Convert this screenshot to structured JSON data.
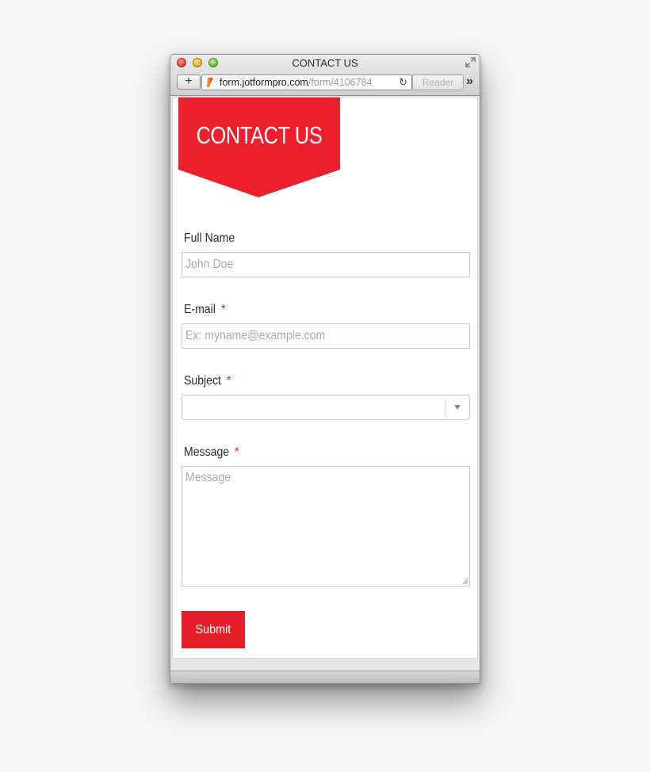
{
  "window": {
    "title": "CONTACT US",
    "url_host": "form.jotformpro.com",
    "url_path": "/form/4106784",
    "reader_label": "Reader"
  },
  "banner": {
    "text": "CONTACT US",
    "color": "#e41f2b"
  },
  "form": {
    "full_name": {
      "label": "Full Name",
      "placeholder": "John Doe"
    },
    "email": {
      "label": "E-mail",
      "required_mark": "*",
      "placeholder": "Ex: myname@example.com"
    },
    "subject": {
      "label": "Subject",
      "required_mark": "*",
      "value": ""
    },
    "message": {
      "label": "Message",
      "required_mark": "*",
      "placeholder": "Message"
    },
    "submit_label": "Submit"
  },
  "icons": {
    "new_tab": "plus-icon",
    "reload": "reload-icon",
    "more": "chevrons-right-icon",
    "fullscreen": "expand-icon",
    "select_arrow": "caret-down-icon"
  }
}
